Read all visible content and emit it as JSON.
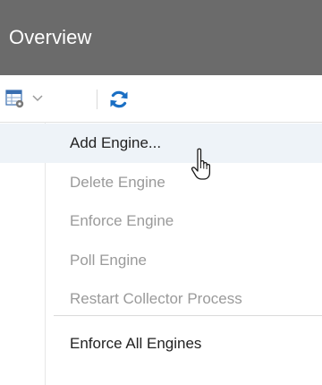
{
  "header": {
    "title": "Overview"
  },
  "toolbar": {
    "menu_icon": "table-settings-icon",
    "dropdown_icon": "chevron-down-icon",
    "refresh_icon": "refresh-icon",
    "accent_color": "#1a6fc4"
  },
  "menu": {
    "items": [
      {
        "label": "Add Engine...",
        "enabled": true,
        "hovered": true
      },
      {
        "label": "Delete Engine",
        "enabled": false
      },
      {
        "label": "Enforce Engine",
        "enabled": false
      },
      {
        "label": "Poll Engine",
        "enabled": false
      },
      {
        "label": "Restart Collector Process",
        "enabled": false
      },
      {
        "label": "Enforce All Engines",
        "enabled": true
      }
    ]
  },
  "cursor": {
    "icon": "hand-pointer-icon"
  }
}
